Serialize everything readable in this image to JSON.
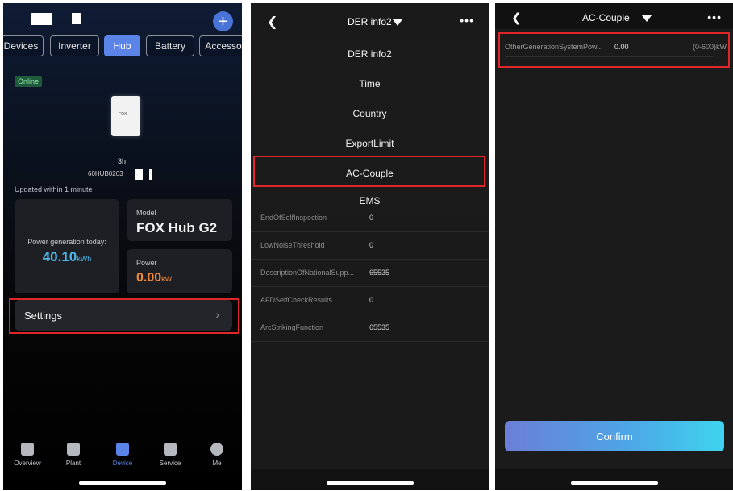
{
  "panel1": {
    "tabs": [
      "Devices",
      "Inverter",
      "Hub",
      "Battery",
      "Accesso"
    ],
    "active_tab": "Hub",
    "status_badge": "Online",
    "device_brand": "FOX",
    "sn_suffix": "3h",
    "sn_prefix": "60HUB0203",
    "updated_text": "Updated  within 1 minute",
    "generation": {
      "label": "Power generation today:",
      "value": "40.10",
      "unit": "kWh"
    },
    "model": {
      "label": "Model",
      "value": "FOX Hub G2"
    },
    "power": {
      "label": "Power",
      "value": "0.00",
      "unit": "kW"
    },
    "settings_label": "Settings",
    "nav": [
      {
        "label": "Overview",
        "icon": "overview-icon"
      },
      {
        "label": "Plant",
        "icon": "plant-icon"
      },
      {
        "label": "Device",
        "icon": "device-icon"
      },
      {
        "label": "Service",
        "icon": "service-icon"
      },
      {
        "label": "Me",
        "icon": "me-icon"
      }
    ],
    "active_nav": "Device",
    "accent_color": "#5b84e8",
    "highlight_color": "#e0252b"
  },
  "panel2": {
    "title": "DER info2",
    "menu": [
      "DER info2",
      "Time",
      "Country",
      "ExportLimit",
      "AC-Couple",
      "EMS"
    ],
    "selected": "AC-Couple",
    "params": [
      {
        "key": "EndOfSelfInspection",
        "value": "0"
      },
      {
        "key": "LowNoiseThreshold",
        "value": "0"
      },
      {
        "key": "DescriptionOfNationalSupp...",
        "value": "65535"
      },
      {
        "key": "AFDSelfCheckResults",
        "value": "0"
      },
      {
        "key": "ArcStrikingFunction",
        "value": "65535"
      }
    ]
  },
  "panel3": {
    "title": "AC-Couple",
    "row": {
      "key": "OtherGenerationSystemPow...",
      "value": "0.00",
      "range": "(0-600)kW"
    },
    "confirm_label": "Confirm"
  }
}
